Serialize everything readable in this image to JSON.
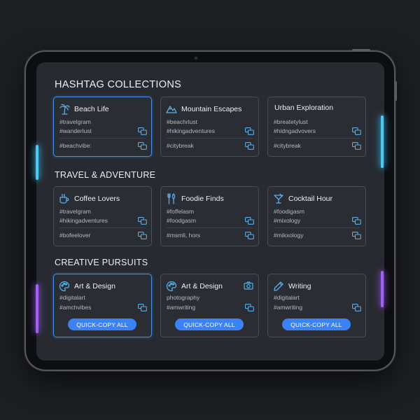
{
  "colors": {
    "accent": "#3b82f6",
    "icon": "#5aaee8",
    "glow_cyan": "#4fc8f0",
    "glow_purple": "#a060f0"
  },
  "sections": [
    {
      "title": "HASHTAG COLLECTIONS",
      "cards": [
        {
          "title": "Beach Life",
          "icon": "palm-tree-icon",
          "tags": [
            "#travelgram",
            "#wanderlust",
            "#beachvibe:"
          ]
        },
        {
          "title": "Mountain Escapes",
          "icon": "mountain-icon",
          "tags": [
            "#beachrlust",
            "#hikingadventures",
            "#citybreak"
          ]
        },
        {
          "title": "Urban Exploration",
          "icon": "",
          "tags": [
            "#breatetylust",
            "#hidngadvovers",
            "#citybreak"
          ]
        }
      ]
    },
    {
      "title": "TRAVEL & ADVENTURE",
      "cards": [
        {
          "title": "Coffee Lovers",
          "icon": "coffee-cup-icon",
          "tags": [
            "#travelgram",
            "#hikingadventures",
            "#bofeelover"
          ]
        },
        {
          "title": "Foodie Finds",
          "icon": "fork-knife-icon",
          "tags": [
            "#foffelasm",
            "#foodgasm",
            "#msmli, hors"
          ]
        },
        {
          "title": "Cocktail Hour",
          "icon": "cocktail-glass-icon",
          "tags": [
            "#foodigasm",
            "#mixology",
            "#mikxology"
          ]
        }
      ]
    },
    {
      "title": "CREATIVE PURSUITS",
      "cards": [
        {
          "title": "Art & Design",
          "icon": "palette-icon",
          "tags": [
            "#digitalart",
            "#amchvibes"
          ],
          "button": "QUICK-COPY ALL"
        },
        {
          "title": "Art & Design",
          "icon": "palette-icon",
          "right_icon": "camera-icon",
          "tags": [
            "photography",
            "#amwriting"
          ],
          "button": "QUICK-COPY ALL"
        },
        {
          "title": "Writing",
          "icon": "pencil-icon",
          "tags": [
            "#digitalart",
            "#amwriting"
          ],
          "button": "QUICK-COPY ALL"
        }
      ]
    }
  ]
}
